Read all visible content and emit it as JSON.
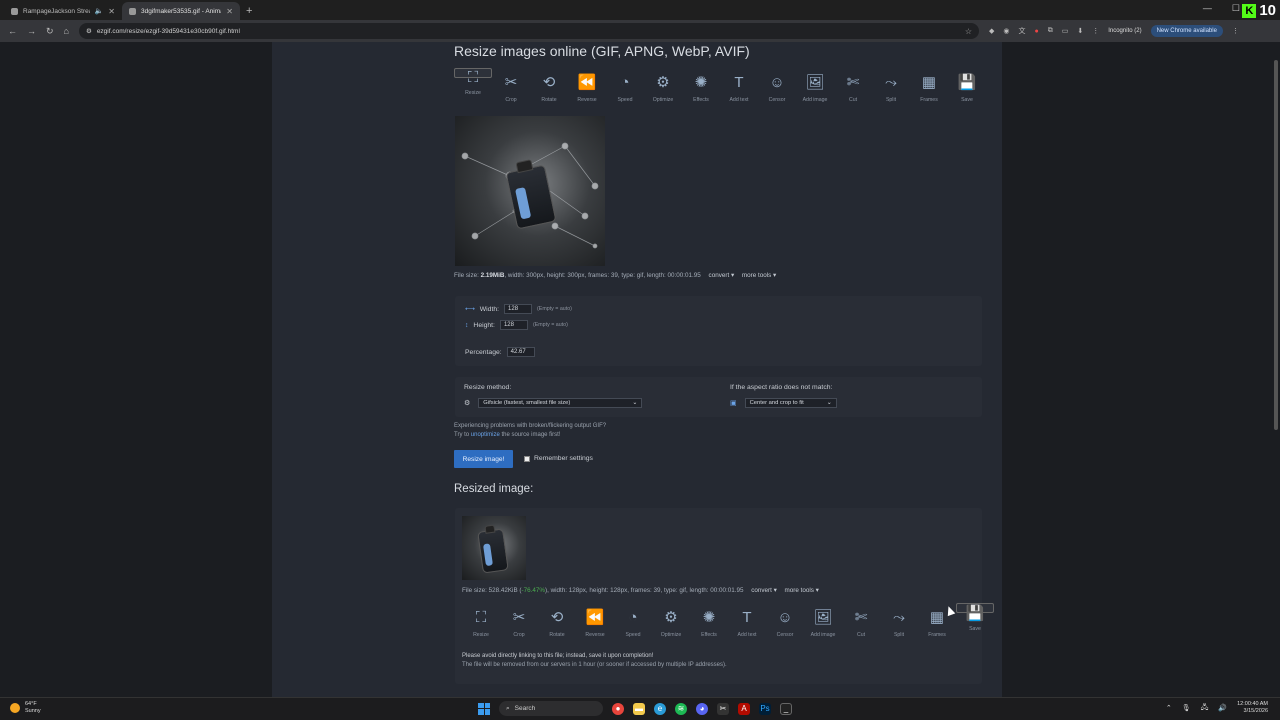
{
  "browser": {
    "tabs": [
      {
        "title": "RampageJackson Stream - ",
        "active": false,
        "audio": true
      },
      {
        "title": "3dgifmaker53535.gif - Animate",
        "active": true,
        "audio": false
      }
    ],
    "new_tab": "+",
    "url": "ezgif.com/resize/ezgif-39d59431e30cb90f.gif.html",
    "incognito": "Incognito (2)",
    "new_chrome": "New Chrome available",
    "kick_count": "10"
  },
  "page": {
    "title": "Resize images online (GIF, APNG, WebP, AVIF)",
    "tools": [
      "Resize",
      "Crop",
      "Rotate",
      "Reverse",
      "Speed",
      "Optimize",
      "Effects",
      "Add text",
      "Censor",
      "Add image",
      "Cut",
      "Split",
      "Frames",
      "Save"
    ],
    "tool_icons": [
      "resize-icon",
      "crop-icon",
      "rotate-icon",
      "reverse-icon",
      "speed-icon",
      "optimize-icon",
      "effects-icon",
      "add-text-icon",
      "censor-icon",
      "add-image-icon",
      "cut-icon",
      "split-icon",
      "frames-icon",
      "save-icon"
    ],
    "source_info": {
      "label": "File size: ",
      "size": "2.19MiB",
      "rest": ", width: 300px, height: 300px, frames: 39, type: gif, length: 00:00:01.95",
      "convert": "convert ▾",
      "more_tools": "more tools ▾"
    },
    "form": {
      "width_label": "Width:",
      "width_value": "128",
      "width_hint": "(Empty = auto)",
      "height_label": "Height:",
      "height_value": "128",
      "height_hint": "(Empty = auto)",
      "percentage_label": "Percentage:",
      "percentage_value": "42.67",
      "method_label": "Resize method:",
      "method_value": "Gifsicle (fastest, smallest file size)",
      "aspect_label": "If the aspect ratio does not match:",
      "aspect_value": "Center and crop to fit",
      "note_line1": "Experiencing problems with broken/flickering output GIF?",
      "note_line2_pre": "Try to ",
      "note_link": "unoptimize",
      "note_line2_post": " the source image first!",
      "submit": "Resize image!",
      "remember": "Remember settings"
    },
    "result_heading": "Resized image:",
    "result_info": {
      "label": "File size: ",
      "size": "528.42KiB",
      "pct_pre": " (",
      "pct": "-76.47%",
      "rest": "), width: 128px, height: 128px, frames: 39, type: gif, length: 00:00:01.95",
      "convert": "convert ▾",
      "more_tools": "more tools ▾"
    },
    "warning1": "Please avoid directly linking to this file; instead, save it upon completion!",
    "warning2": "The file will be removed from our servers in 1 hour (or sooner if accessed by multiple IP addresses)."
  },
  "taskbar": {
    "temp": "64°F",
    "weather": "Sunny",
    "search": "Search",
    "time": "12:00:40 AM",
    "date": "3/15/2026"
  }
}
